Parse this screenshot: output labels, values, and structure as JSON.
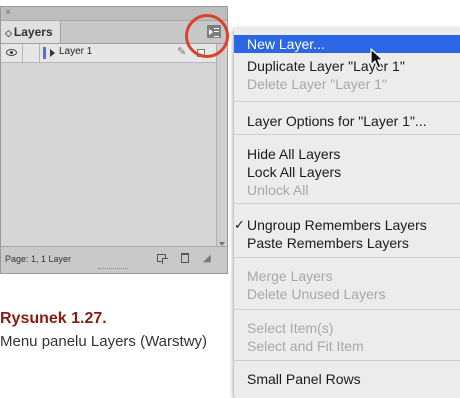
{
  "panel": {
    "close_glyph": "×",
    "tab_label": "Layers",
    "tab_arrows": "◇",
    "menu_button_icon": "panel-menu-icon",
    "layer_row": {
      "name": "Layer 1",
      "color": "#4a72e8"
    },
    "footer": {
      "page_info": "Page: 1, 1 Layer"
    }
  },
  "caption": {
    "title": "Rysunek 1.27.",
    "text": "Menu panelu Layers (Warstwy)"
  },
  "menu": {
    "highlight_color": "#2b67e4",
    "circle_color": "#d9412a",
    "items": [
      {
        "label": "New Layer...",
        "state": "highlighted"
      },
      {
        "label": "Duplicate Layer \"Layer 1\"",
        "state": "enabled"
      },
      {
        "label": "Delete Layer \"Layer 1\"",
        "state": "disabled"
      },
      {
        "label": "Layer Options for \"Layer 1\"...",
        "state": "enabled"
      },
      {
        "label": "Hide All Layers",
        "state": "enabled"
      },
      {
        "label": "Lock All Layers",
        "state": "enabled"
      },
      {
        "label": "Unlock All",
        "state": "disabled"
      },
      {
        "label": "Ungroup Remembers Layers",
        "state": "enabled",
        "checked": true
      },
      {
        "label": "Paste Remembers Layers",
        "state": "enabled"
      },
      {
        "label": "Merge Layers",
        "state": "disabled"
      },
      {
        "label": "Delete Unused Layers",
        "state": "disabled"
      },
      {
        "label": "Select Item(s)",
        "state": "disabled"
      },
      {
        "label": "Select and Fit Item",
        "state": "disabled"
      },
      {
        "label": "Small Panel Rows",
        "state": "enabled"
      }
    ],
    "check_glyph": "✓"
  }
}
